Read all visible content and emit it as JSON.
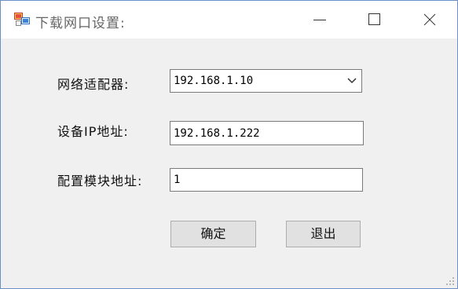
{
  "window": {
    "title": "下载网口设置:",
    "controls": {
      "minimize_icon": "minimize-icon",
      "maximize_icon": "maximize-icon",
      "close_icon": "close-icon"
    }
  },
  "form": {
    "adapter": {
      "label": "网络适配器:",
      "value": "192.168.1.10"
    },
    "device_ip": {
      "label": "设备IP地址:",
      "value": "192.168.1.222"
    },
    "module_address": {
      "label": "配置模块地址:",
      "value": "1"
    }
  },
  "buttons": {
    "confirm": "确定",
    "exit": "退出"
  },
  "colors": {
    "window_border": "#6b8fc6",
    "client_bg": "#f0f0f0",
    "button_bg": "#e1e1e1"
  }
}
